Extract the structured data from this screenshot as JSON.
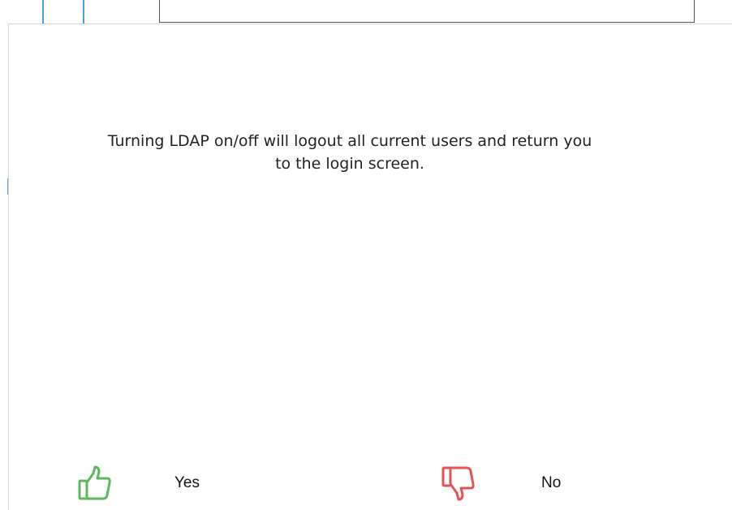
{
  "dialog": {
    "message_line1": "Turning LDAP on/off will logout all current users and return you",
    "message_line2": "to the login screen.",
    "yes": {
      "label": "Yes",
      "icon": "thumbs-up-icon",
      "color": "#5cb85c"
    },
    "no": {
      "label": "No",
      "icon": "thumbs-down-icon",
      "color": "#e55353"
    }
  },
  "colors": {
    "accent": "#4aa3d8",
    "text": "#222222"
  }
}
